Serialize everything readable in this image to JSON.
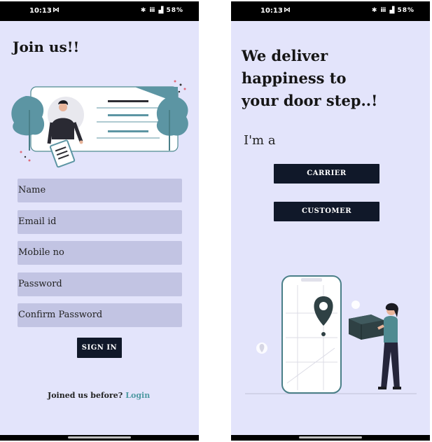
{
  "status_bar": {
    "time": "10:13",
    "battery": "58%",
    "mail_icon": "mail-icon",
    "system_icons": "bluetooth wifi signal"
  },
  "signup_screen": {
    "title": "Join us!!",
    "fields": [
      {
        "placeholder": "Name"
      },
      {
        "placeholder": "Email id"
      },
      {
        "placeholder": "Mobile no"
      },
      {
        "placeholder": "Password"
      },
      {
        "placeholder": "Confirm Password"
      }
    ],
    "sign_in_button": "SIGN IN",
    "footer_prompt": "Joined us before?",
    "login_link": "Login"
  },
  "role_screen": {
    "headline_line1": "We deliver",
    "headline_line2": "happiness to",
    "headline_line3": "your door step..!",
    "prompt": "I'm a",
    "carrier_button": "CARRIER",
    "customer_button": "CUSTOMER"
  },
  "colors": {
    "background": "#e3e4fb",
    "input": "#c2c4e3",
    "button": "#101829",
    "accent": "#4f9aa3"
  }
}
